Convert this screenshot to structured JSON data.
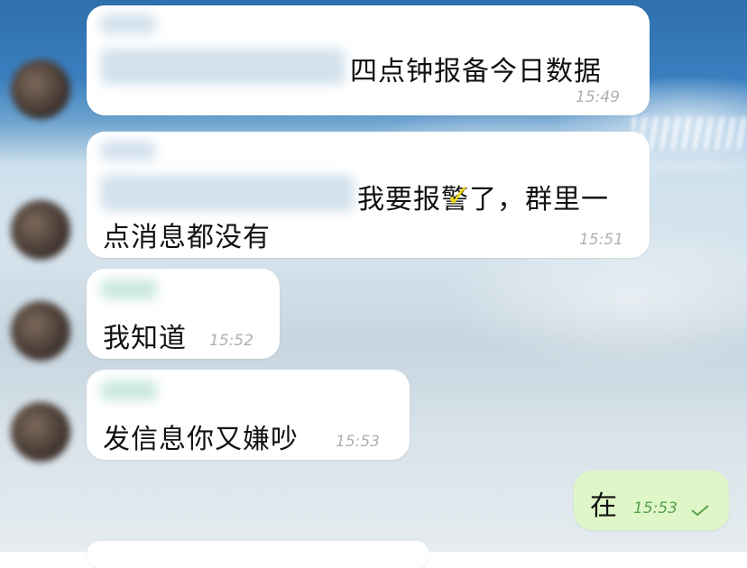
{
  "messages": [
    {
      "text": "四点钟报备今日数据",
      "time": "15:49"
    },
    {
      "text_line1": "我要报警了，群里一",
      "text_line2": "点消息都没有",
      "time": "15:51"
    },
    {
      "text": "我知道",
      "time": "15:52"
    },
    {
      "text": "发信息你又嫌吵",
      "time": "15:53"
    },
    {
      "text": "在",
      "time": "15:53"
    }
  ],
  "icons": {
    "read_check": "checkmark-icon",
    "annotation": "yellow-checkmark-icon"
  },
  "colors": {
    "outgoing_bubble": "#dff7c8",
    "incoming_bubble": "#ffffff",
    "outgoing_time": "#5aa04a",
    "annotation": "#e8d41a"
  }
}
